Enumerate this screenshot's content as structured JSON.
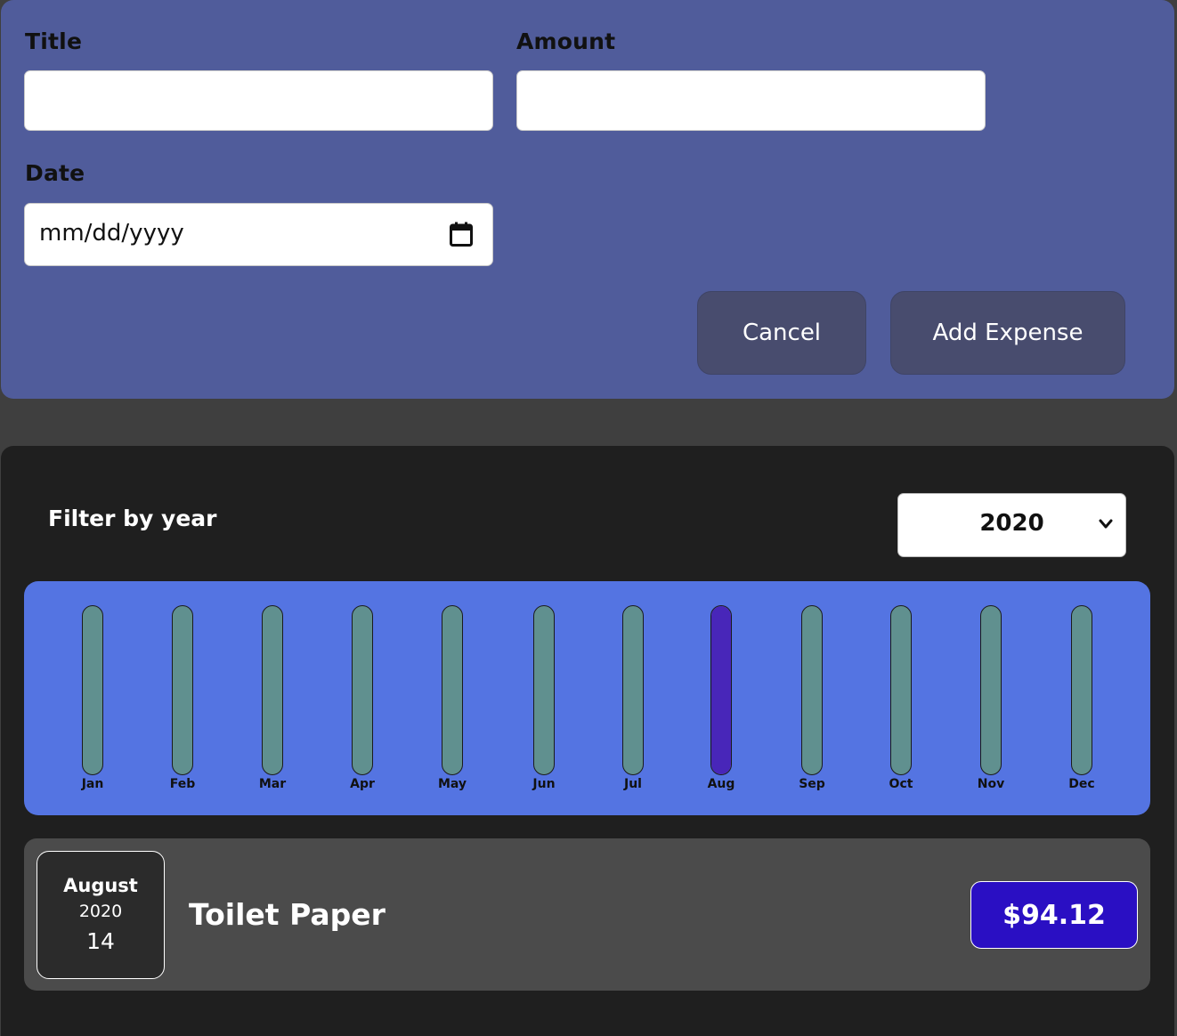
{
  "form": {
    "title_label": "Title",
    "title_value": "",
    "amount_label": "Amount",
    "amount_value": "",
    "date_label": "Date",
    "date_placeholder": "mm/dd/yyyy",
    "cancel_label": "Cancel",
    "submit_label": "Add Expense"
  },
  "filter": {
    "label": "Filter by year",
    "selected_year": "2020"
  },
  "chart_data": {
    "type": "bar",
    "categories": [
      "Jan",
      "Feb",
      "Mar",
      "Apr",
      "May",
      "Jun",
      "Jul",
      "Aug",
      "Sep",
      "Oct",
      "Nov",
      "Dec"
    ],
    "values": [
      0,
      0,
      0,
      0,
      0,
      0,
      0,
      94.12,
      0,
      0,
      0,
      0
    ],
    "ylim": [
      0,
      94.12
    ],
    "colors": {
      "track": "#60908f",
      "fill": "#4826b9",
      "background": "#5474e2"
    }
  },
  "expenses": [
    {
      "month": "August",
      "year": "2020",
      "day": "14",
      "title": "Toilet Paper",
      "amount": "$94.12"
    }
  ]
}
